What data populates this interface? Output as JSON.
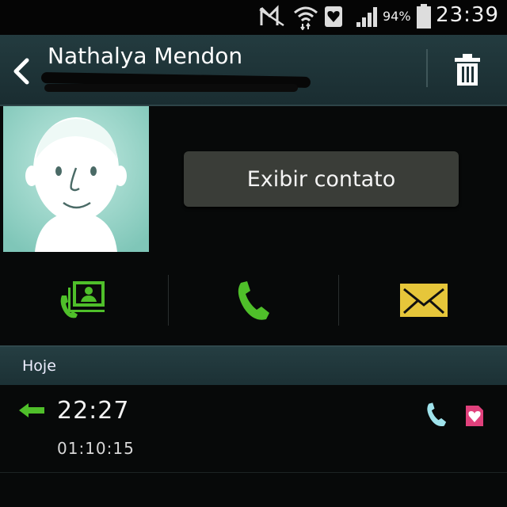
{
  "status_bar": {
    "battery_percent": "94%",
    "time": "23:39",
    "icons": [
      "mute-icon",
      "wifi-icon",
      "notification-heart-icon",
      "signal-icon",
      "battery-icon"
    ]
  },
  "header": {
    "contact_name": "Nathalya Mendon",
    "back_icon": "chevron-left-icon",
    "delete_icon": "trash-icon"
  },
  "contact": {
    "view_contact_label": "Exibir contato",
    "avatar_icon": "default-avatar"
  },
  "actions": [
    {
      "name": "call-log-contact",
      "icon": "contact-card-phone-icon"
    },
    {
      "name": "call",
      "icon": "phone-icon"
    },
    {
      "name": "message",
      "icon": "envelope-icon"
    }
  ],
  "history": {
    "section_title": "Hoje",
    "entries": [
      {
        "time": "22:27",
        "duration": "01:10:15",
        "direction_icon": "incoming-arrow-icon",
        "type_icon": "phone-icon",
        "sim_icon": "sim-heart-icon"
      }
    ]
  },
  "colors": {
    "header_bg": "#233b3f",
    "accent_green": "#4fbf2a",
    "message_yellow": "#e6c63a",
    "sim_pink": "#e0417c",
    "avatar_bg": "#9fd6cc"
  }
}
